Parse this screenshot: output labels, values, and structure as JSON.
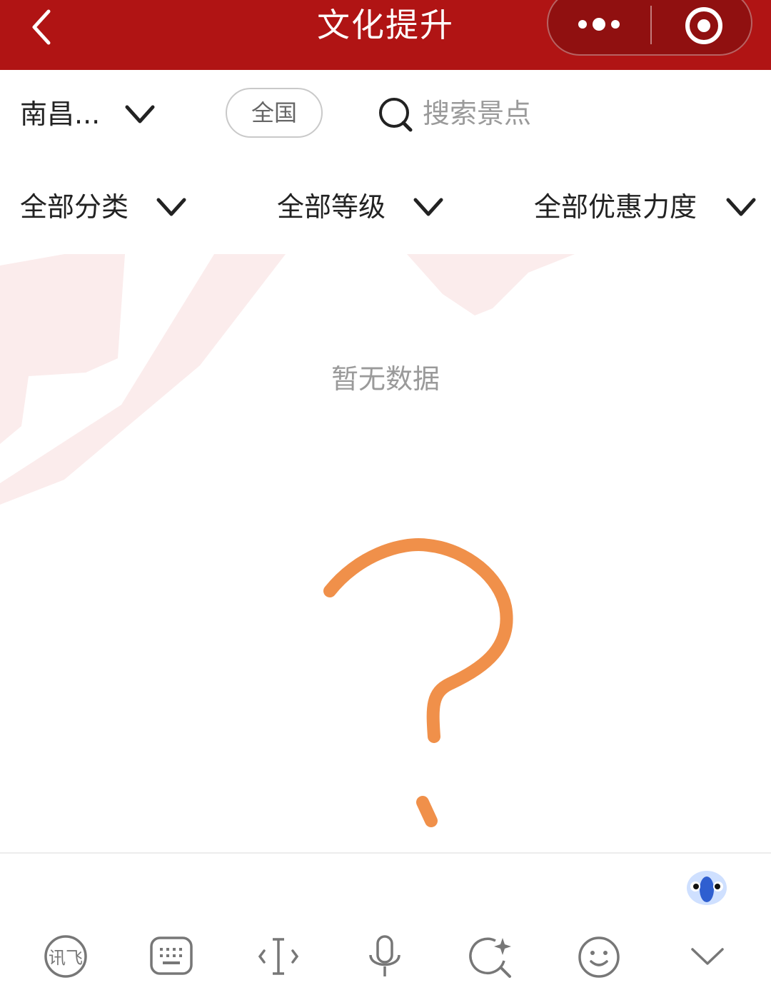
{
  "header": {
    "title": "文化提升"
  },
  "search_row": {
    "city": "南昌...",
    "nation_button": "全国",
    "search_placeholder": "搜索景点"
  },
  "filters": [
    {
      "label": "全部分类"
    },
    {
      "label": "全部等级"
    },
    {
      "label": "全部优惠力度"
    }
  ],
  "empty_state": {
    "message": "暂无数据"
  },
  "colors": {
    "header_bg": "#b01414",
    "doodle_stroke": "#f0904a",
    "watermark": "#fbecec"
  },
  "keyboard_toolbar": {
    "ime_logo_text": "讯飞",
    "icons": [
      "ime-logo-icon",
      "keyboard-icon",
      "cursor-icon",
      "microphone-icon",
      "ai-search-icon",
      "emoji-icon",
      "collapse-chevron-icon"
    ]
  }
}
